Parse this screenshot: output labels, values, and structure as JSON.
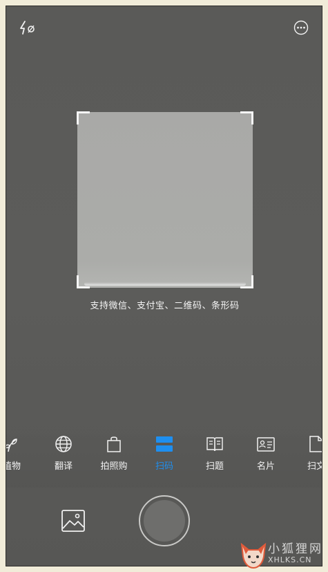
{
  "top_bar": {
    "flash_icon": "flash-auto-icon",
    "more_icon": "more-options-icon"
  },
  "scanner": {
    "hint": "支持微信、支付宝、二维码、条形码"
  },
  "mode_tabs": [
    {
      "label": "植物",
      "icon": "plant-icon",
      "active": false
    },
    {
      "label": "翻译",
      "icon": "globe-icon",
      "active": false
    },
    {
      "label": "拍照购",
      "icon": "shopping-bag-icon",
      "active": false
    },
    {
      "label": "扫码",
      "icon": "scan-code-icon",
      "active": true
    },
    {
      "label": "扫题",
      "icon": "book-icon",
      "active": false
    },
    {
      "label": "名片",
      "icon": "business-card-icon",
      "active": false
    },
    {
      "label": "扫文",
      "icon": "document-icon",
      "active": false
    }
  ],
  "bottom_bar": {
    "gallery_icon": "gallery-icon",
    "shutter": "shutter-button"
  },
  "watermark": {
    "name": "小狐狸网",
    "url": "XHLKS.CN"
  },
  "colors": {
    "accent": "#1e8ff0",
    "background": "#5a5a58"
  }
}
